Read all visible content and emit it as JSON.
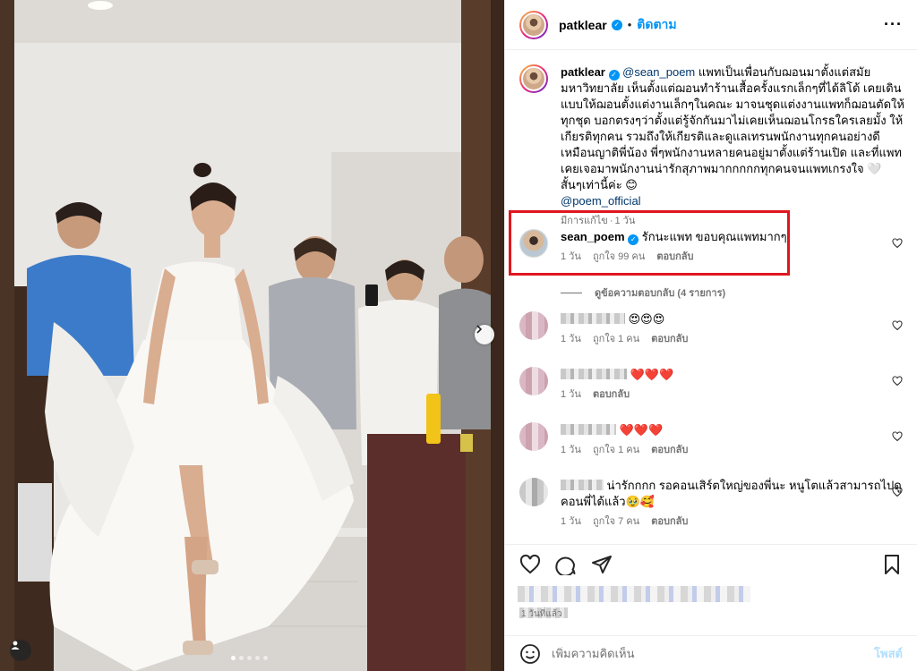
{
  "header": {
    "username": "patklear",
    "follow_label": "ติดตาม",
    "more_icon": "more-horizontal-icon"
  },
  "caption": {
    "username": "patklear",
    "mention": "@sean_poem",
    "text": " แพทเป็นเพื่อนกับฌอนมาตั้งแต่สมัยมหาวิทยาลัย เห็นตั้งแต่ฌอนทำร้านเสื้อครั้งแรกเล็กๆที่ได้ลิโด้ เคยเดินแบบให้ฌอนตั้งแต่งานเล็กๆในคณะ มาจนชุดแต่งงานแพทก็ฌอนตัดให้ทุกชุด บอกตรงๆว่าตั้งแต่รู้จักกันมาไม่เคยเห็นฌอนโกรธใครเลยมั้ง ให้เกียรติทุกคน รวมถึงให้เกียรติและดูแลเทรนพนักงานทุกคนอย่างดีเหมือนญาติพี่น้อง พี่ๆพนักงานหลายคนอยู่มาตั้งแต่ร้านเปิด และที่แพทเคยเจอมาพนักงานน่ารักสุภาพมากกกกกทุกคนจนแพทเกรงใจ 🤍 สั้นๆเท่านี้ค่ะ 😊",
    "tag": "@poem_official",
    "edited": "มีการแก้ไข",
    "time": "1 วัน"
  },
  "comments": [
    {
      "username": "sean_poem",
      "text": "รักนะแพท ขอบคุณแพทมากๆ",
      "time": "1 วัน",
      "likes": "ถูกใจ 99 คน",
      "reply": "ตอบกลับ",
      "view_replies": "ดูข้อความตอบกลับ (4 รายการ)"
    },
    {
      "text": "😍😍😍",
      "time": "1 วัน",
      "likes": "ถูกใจ 1 คน",
      "reply": "ตอบกลับ"
    },
    {
      "text": "❤️❤️❤️",
      "time": "1 วัน",
      "reply": "ตอบกลับ"
    },
    {
      "text": "❤️❤️❤️",
      "time": "1 วัน",
      "likes": "ถูกใจ 1 คน",
      "reply": "ตอบกลับ"
    },
    {
      "text": "น่ารักกกก รอคอนเสิร์ตใหญ่ของพี่นะ หนูโตแล้วสามารถไปดูคอนพี่ได้แล้ว🥹🥰",
      "time": "1 วัน",
      "likes": "ถูกใจ 7 คน",
      "reply": "ตอบกลับ"
    }
  ],
  "actions": {
    "icons": [
      "heart-icon",
      "comment-icon",
      "share-icon",
      "bookmark-icon"
    ],
    "time_text": "1 วันที่แล้ว"
  },
  "add_comment": {
    "placeholder": "เพิ่มความคิดเห็น",
    "post_label": "โพสต์"
  },
  "colors": {
    "link": "#0095f6",
    "mention": "#00376b",
    "highlight_border": "#e0161f",
    "muted": "#737373"
  }
}
